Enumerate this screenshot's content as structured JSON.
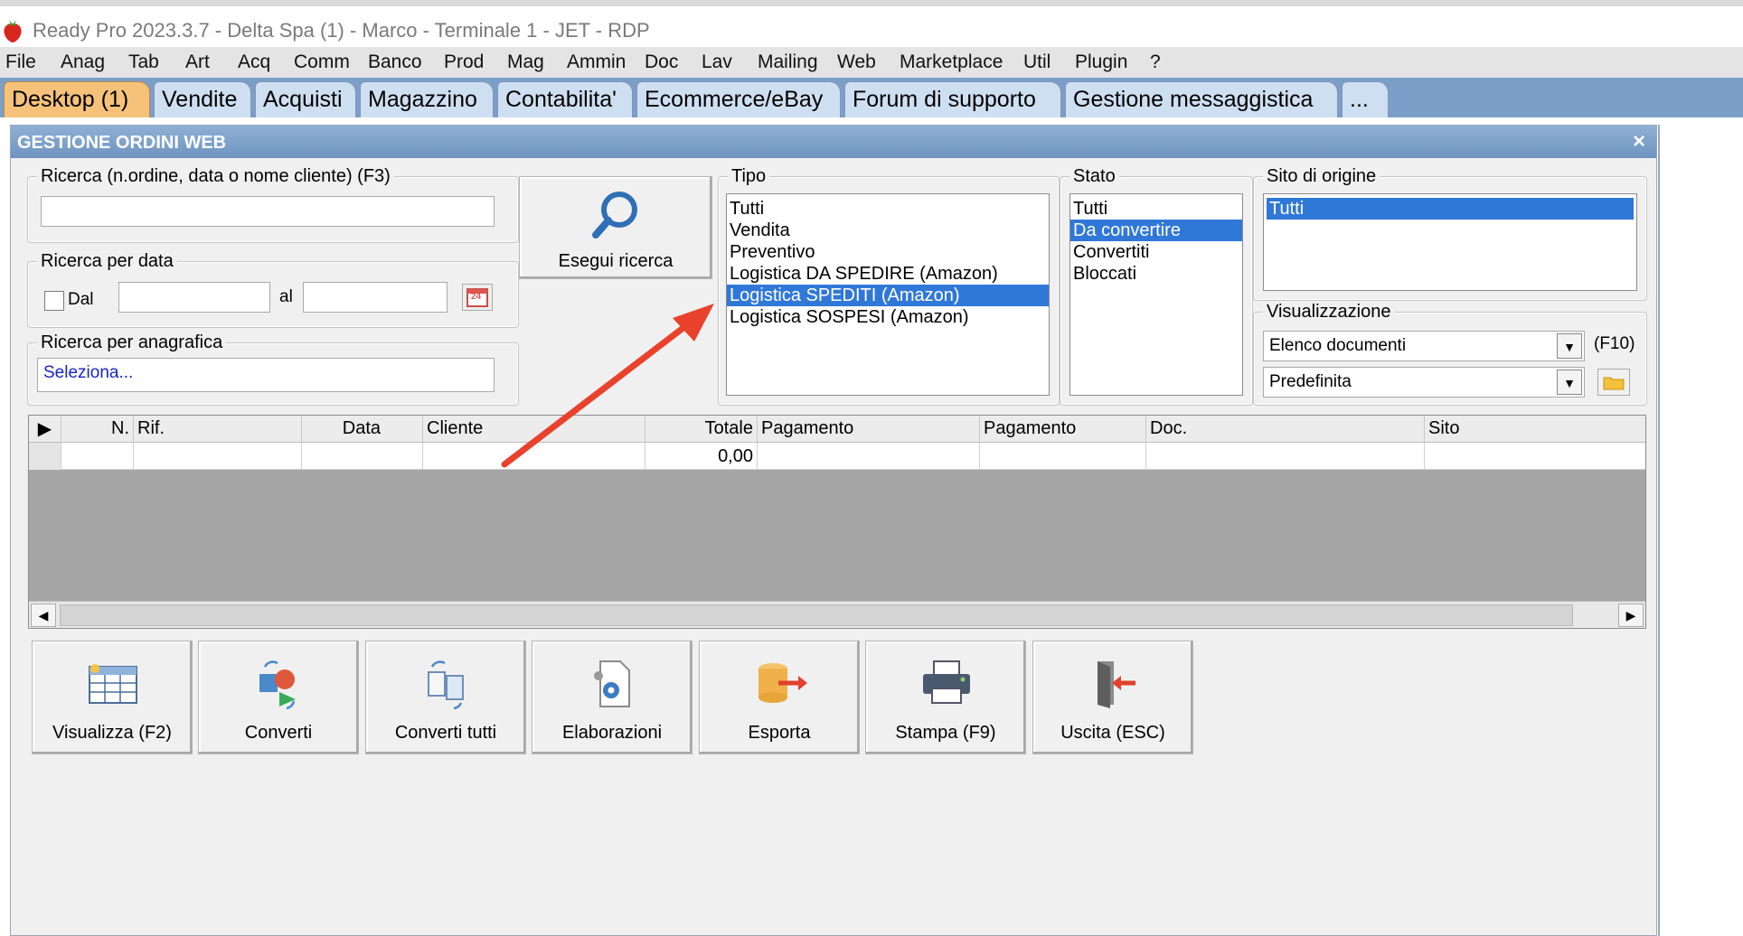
{
  "window_title": "Ready Pro 2023.3.7 - Delta Spa (1) - Marco - Terminale 1 - JET - RDP",
  "menu": [
    "File",
    "Anag",
    "Tab",
    "Art",
    "Acq",
    "Comm",
    "Banco",
    "Prod",
    "Mag",
    "Ammin",
    "Doc",
    "Lav",
    "Mailing",
    "Web",
    "Marketplace",
    "Util",
    "Plugin",
    "?"
  ],
  "tabs": [
    {
      "label": "Desktop (1)",
      "active": true
    },
    {
      "label": "Vendite"
    },
    {
      "label": "Acquisti"
    },
    {
      "label": "Magazzino"
    },
    {
      "label": "Contabilita'"
    },
    {
      "label": "Ecommerce/eBay"
    },
    {
      "label": "Forum di supporto"
    },
    {
      "label": "Gestione messaggistica"
    },
    {
      "label": "..."
    }
  ],
  "panel": {
    "title": "GESTIONE ORDINI WEB",
    "close": "×"
  },
  "search": {
    "legend": "Ricerca (n.ordine, data o nome cliente) (F3)",
    "value": ""
  },
  "date_search": {
    "legend": "Ricerca per data",
    "from_label": "Dal",
    "to_label": "al",
    "from_value": "",
    "to_value": "",
    "calendar_day": "24"
  },
  "anagrafica": {
    "legend": "Ricerca per anagrafica",
    "value": "Seleziona..."
  },
  "search_button": "Esegui ricerca",
  "tipo": {
    "legend": "Tipo",
    "items": [
      "Tutti",
      "Vendita",
      "Preventivo",
      "Logistica DA SPEDIRE (Amazon)",
      "Logistica SPEDITI (Amazon)",
      "Logistica SOSPESI (Amazon)"
    ],
    "selected": 4
  },
  "stato": {
    "legend": "Stato",
    "items": [
      "Tutti",
      "Da convertire",
      "Convertiti",
      "Bloccati"
    ],
    "selected": 1
  },
  "sito": {
    "legend": "Sito di origine",
    "items": [
      "Tutti"
    ],
    "selected": 0
  },
  "visualizzazione": {
    "legend": "Visualizzazione",
    "combo1": "Elenco documenti",
    "shortcut": "(F10)",
    "combo2": "Predefinita"
  },
  "grid": {
    "columns": [
      "N.",
      "Rif.",
      "Data",
      "Cliente",
      "Totale",
      "Pagamento",
      "Pagamento",
      "Doc.",
      "Sito"
    ],
    "rows": [
      [
        "",
        "",
        "",
        "",
        "0,00",
        "",
        "",
        "",
        ""
      ]
    ]
  },
  "actions": [
    "Visualizza (F2)",
    "Converti",
    "Converti tutti",
    "Elaborazioni",
    "Esporta",
    "Stampa (F9)",
    "Uscita (ESC)"
  ],
  "colors": {
    "accent_blue": "#3078d8",
    "tab_active": "#f6c27a",
    "tabbar": "#7b9fc9",
    "arrow_red": "#e8412c"
  }
}
